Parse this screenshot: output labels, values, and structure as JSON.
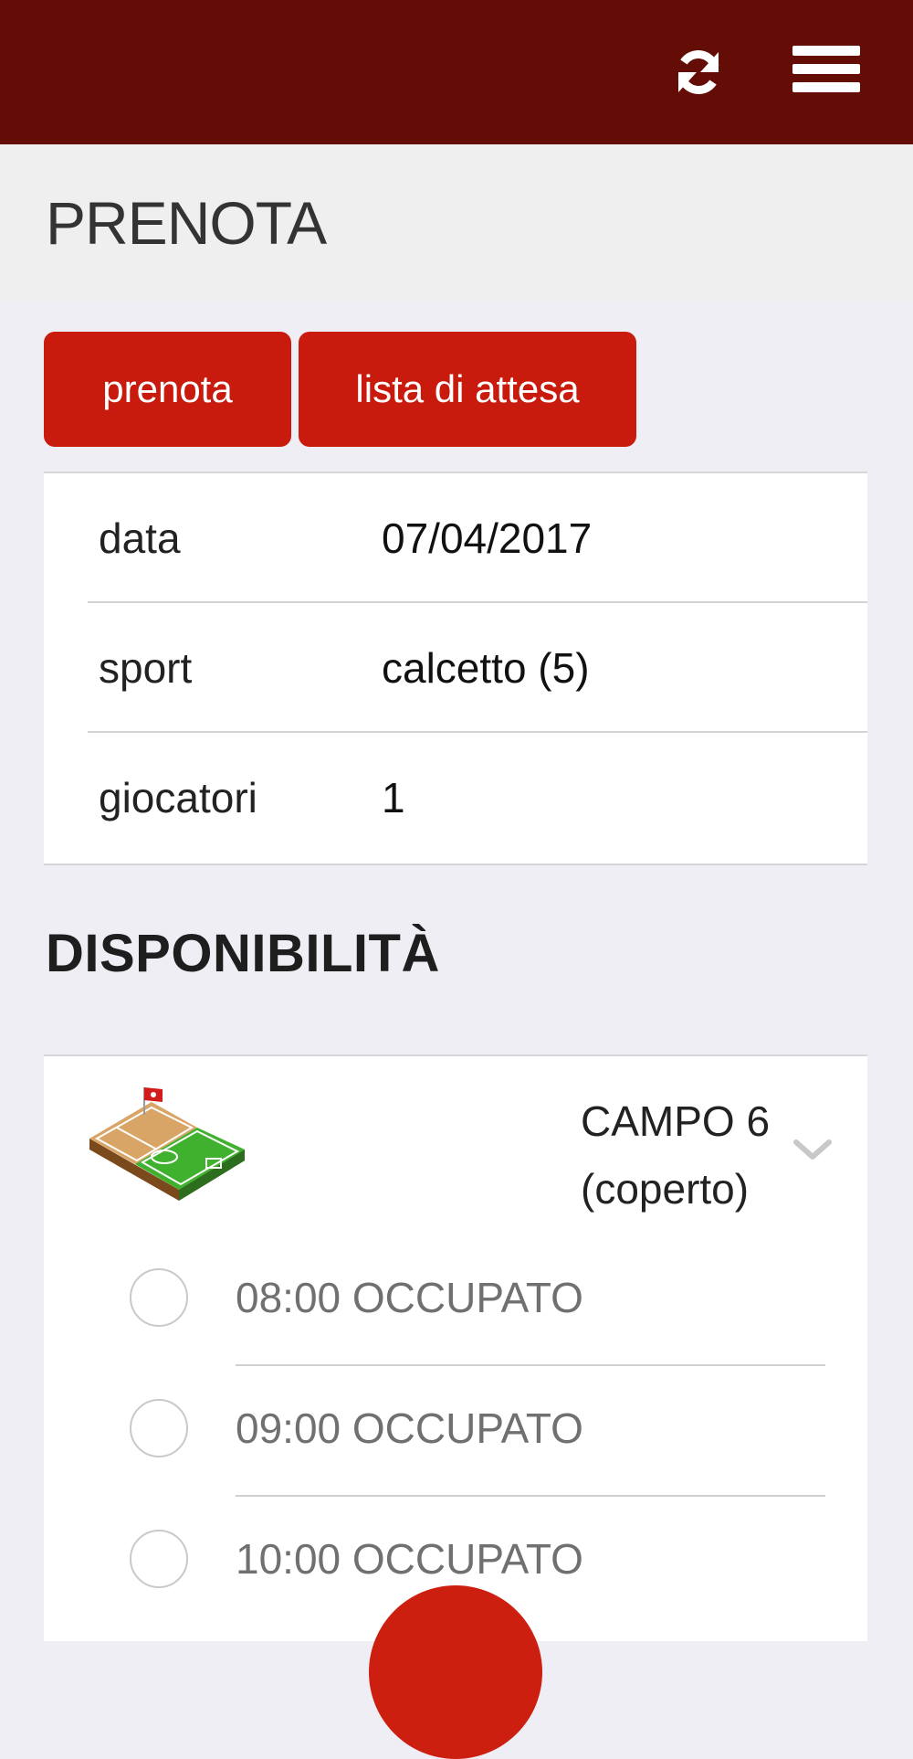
{
  "header": {
    "refresh_icon": "refresh-icon",
    "menu_icon": "hamburger-menu-icon",
    "background_color": "#640d07"
  },
  "page": {
    "title": "PRENOTA"
  },
  "actions": {
    "book_label": "prenota",
    "waitlist_label": "lista di attesa",
    "button_color": "#c81b0d"
  },
  "form": {
    "rows": [
      {
        "label": "data",
        "value": "07/04/2017"
      },
      {
        "label": "sport",
        "value": "calcetto (5)"
      },
      {
        "label": "giocatori",
        "value": "1"
      }
    ]
  },
  "availability": {
    "heading": "DISPONIBILITÀ",
    "court": {
      "name_line1": "CAMPO 6",
      "name_line2": "(coperto)",
      "icon": "court-field-icon"
    },
    "slots": [
      {
        "label": "08:00 OCCUPATO",
        "selected": false
      },
      {
        "label": "09:00 OCCUPATO",
        "selected": false
      },
      {
        "label": "10:00 OCCUPATO",
        "selected": false
      }
    ]
  }
}
